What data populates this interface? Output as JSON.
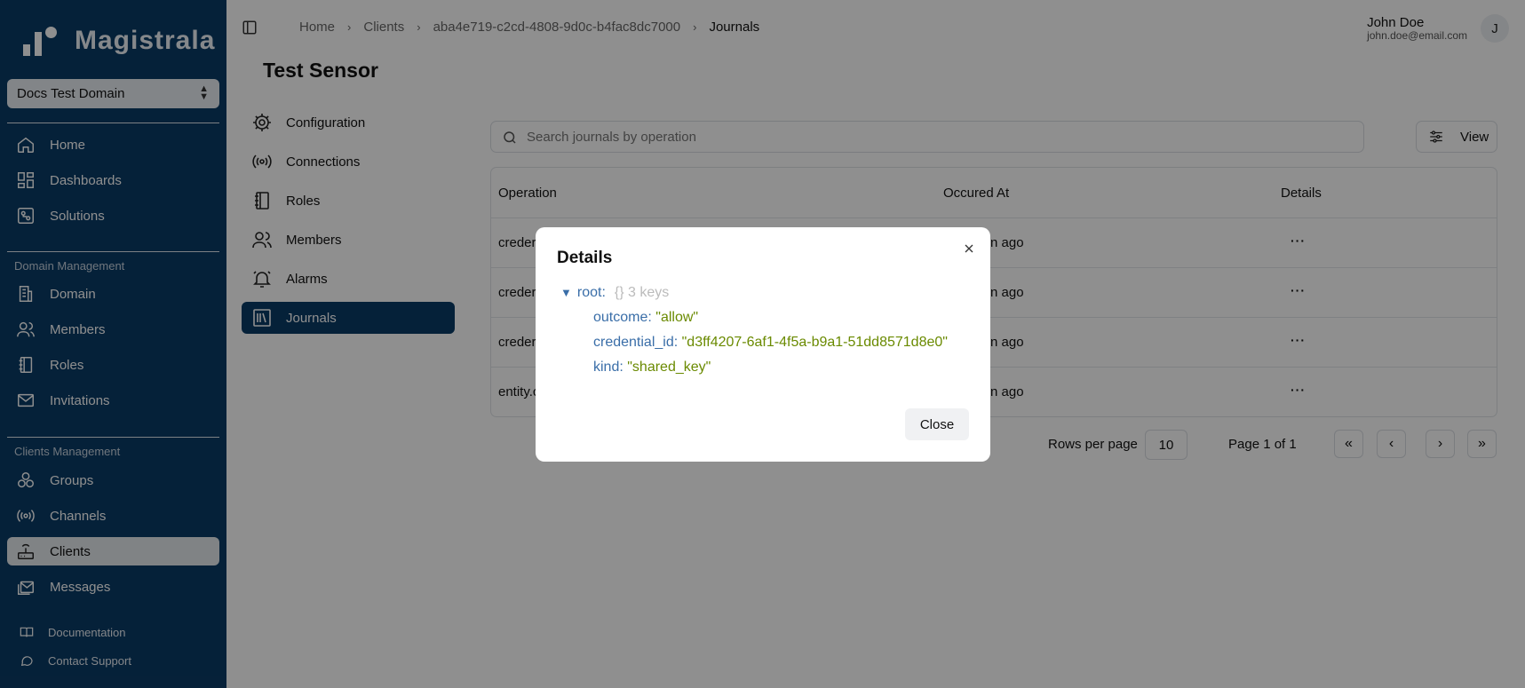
{
  "brand": {
    "name": "Magistrala"
  },
  "domain_selector": {
    "value": "Docs Test Domain"
  },
  "sidebar": {
    "main_items": [
      {
        "label": "Home",
        "icon": "home-icon"
      },
      {
        "label": "Dashboards",
        "icon": "dashboard-icon"
      },
      {
        "label": "Solutions",
        "icon": "solutions-icon"
      }
    ],
    "domain_section": "Domain Management",
    "domain_items": [
      {
        "label": "Domain",
        "icon": "building-icon"
      },
      {
        "label": "Members",
        "icon": "users-icon"
      },
      {
        "label": "Roles",
        "icon": "notebook-icon"
      },
      {
        "label": "Invitations",
        "icon": "mail-icon"
      }
    ],
    "clients_section": "Clients Management",
    "clients_items": [
      {
        "label": "Groups",
        "icon": "groups-icon"
      },
      {
        "label": "Channels",
        "icon": "radio-icon"
      },
      {
        "label": "Clients",
        "icon": "router-icon",
        "active": true
      },
      {
        "label": "Messages",
        "icon": "messages-icon"
      }
    ],
    "footer_items": [
      {
        "label": "Documentation",
        "icon": "book-icon"
      },
      {
        "label": "Contact Support",
        "icon": "chat-icon"
      }
    ]
  },
  "breadcrumb": [
    "Home",
    "Clients",
    "aba4e719-c2cd-4808-9d0c-b4fac8dc7000",
    "Journals"
  ],
  "user": {
    "name": "John Doe",
    "email": "john.doe@email.com",
    "initial": "J"
  },
  "page": {
    "title": "Test Sensor"
  },
  "tabs": [
    {
      "label": "Configuration",
      "icon": "gear-icon"
    },
    {
      "label": "Connections",
      "icon": "radio-icon"
    },
    {
      "label": "Roles",
      "icon": "notebook-icon"
    },
    {
      "label": "Members",
      "icon": "users-icon"
    },
    {
      "label": "Alarms",
      "icon": "bell-icon"
    },
    {
      "label": "Journals",
      "icon": "library-icon",
      "active": true
    }
  ],
  "search": {
    "placeholder": "Search journals by operation"
  },
  "view_button": {
    "label": "View"
  },
  "table": {
    "headers": [
      "Operation",
      "Occured At",
      "Details"
    ],
    "rows": [
      {
        "operation": "creder",
        "occured": "n ago"
      },
      {
        "operation": "creder",
        "occured": "n ago"
      },
      {
        "operation": "creder",
        "occured": "n ago"
      },
      {
        "operation": "entity.c",
        "occured": "n ago"
      }
    ],
    "details_glyph": "···"
  },
  "pagination": {
    "rows_per_page_label": "Rows per page",
    "rows_per_page": "10",
    "page_label": "Page 1 of 1"
  },
  "dialog": {
    "title": "Details",
    "root_key": "root:",
    "root_meta": "{}  3 keys",
    "entries": [
      {
        "key": "outcome:",
        "value": "\"allow\""
      },
      {
        "key": "credential_id:",
        "value": "\"d3ff4207-6af1-4f5a-b9a1-51dd8571d8e0\""
      },
      {
        "key": "kind:",
        "value": "\"shared_key\""
      }
    ],
    "close_label": "Close"
  }
}
